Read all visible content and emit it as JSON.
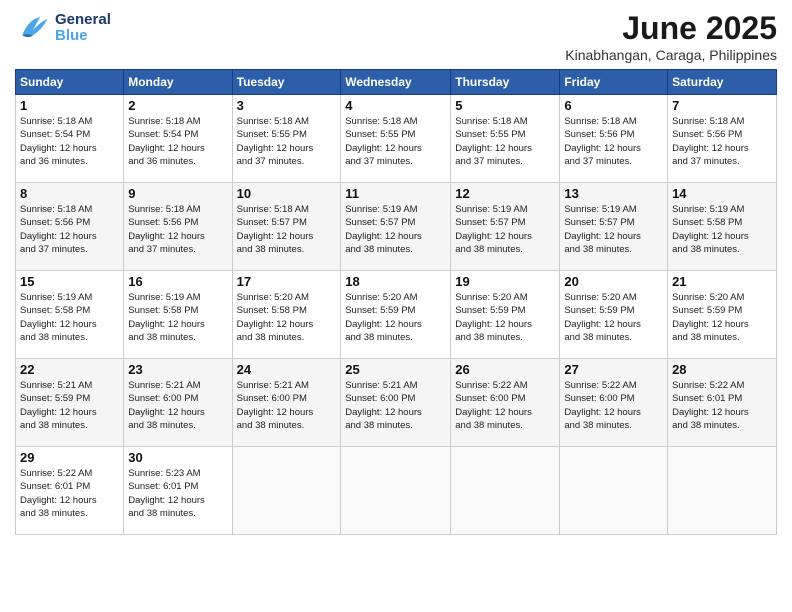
{
  "header": {
    "logo_general": "General",
    "logo_blue": "Blue",
    "title": "June 2025",
    "subtitle": "Kinabhangan, Caraga, Philippines"
  },
  "days_of_week": [
    "Sunday",
    "Monday",
    "Tuesday",
    "Wednesday",
    "Thursday",
    "Friday",
    "Saturday"
  ],
  "weeks": [
    [
      {
        "day": "1",
        "info": "Sunrise: 5:18 AM\nSunset: 5:54 PM\nDaylight: 12 hours\nand 36 minutes."
      },
      {
        "day": "2",
        "info": "Sunrise: 5:18 AM\nSunset: 5:54 PM\nDaylight: 12 hours\nand 36 minutes."
      },
      {
        "day": "3",
        "info": "Sunrise: 5:18 AM\nSunset: 5:55 PM\nDaylight: 12 hours\nand 37 minutes."
      },
      {
        "day": "4",
        "info": "Sunrise: 5:18 AM\nSunset: 5:55 PM\nDaylight: 12 hours\nand 37 minutes."
      },
      {
        "day": "5",
        "info": "Sunrise: 5:18 AM\nSunset: 5:55 PM\nDaylight: 12 hours\nand 37 minutes."
      },
      {
        "day": "6",
        "info": "Sunrise: 5:18 AM\nSunset: 5:56 PM\nDaylight: 12 hours\nand 37 minutes."
      },
      {
        "day": "7",
        "info": "Sunrise: 5:18 AM\nSunset: 5:56 PM\nDaylight: 12 hours\nand 37 minutes."
      }
    ],
    [
      {
        "day": "8",
        "info": "Sunrise: 5:18 AM\nSunset: 5:56 PM\nDaylight: 12 hours\nand 37 minutes."
      },
      {
        "day": "9",
        "info": "Sunrise: 5:18 AM\nSunset: 5:56 PM\nDaylight: 12 hours\nand 37 minutes."
      },
      {
        "day": "10",
        "info": "Sunrise: 5:18 AM\nSunset: 5:57 PM\nDaylight: 12 hours\nand 38 minutes."
      },
      {
        "day": "11",
        "info": "Sunrise: 5:19 AM\nSunset: 5:57 PM\nDaylight: 12 hours\nand 38 minutes."
      },
      {
        "day": "12",
        "info": "Sunrise: 5:19 AM\nSunset: 5:57 PM\nDaylight: 12 hours\nand 38 minutes."
      },
      {
        "day": "13",
        "info": "Sunrise: 5:19 AM\nSunset: 5:57 PM\nDaylight: 12 hours\nand 38 minutes."
      },
      {
        "day": "14",
        "info": "Sunrise: 5:19 AM\nSunset: 5:58 PM\nDaylight: 12 hours\nand 38 minutes."
      }
    ],
    [
      {
        "day": "15",
        "info": "Sunrise: 5:19 AM\nSunset: 5:58 PM\nDaylight: 12 hours\nand 38 minutes."
      },
      {
        "day": "16",
        "info": "Sunrise: 5:19 AM\nSunset: 5:58 PM\nDaylight: 12 hours\nand 38 minutes."
      },
      {
        "day": "17",
        "info": "Sunrise: 5:20 AM\nSunset: 5:58 PM\nDaylight: 12 hours\nand 38 minutes."
      },
      {
        "day": "18",
        "info": "Sunrise: 5:20 AM\nSunset: 5:59 PM\nDaylight: 12 hours\nand 38 minutes."
      },
      {
        "day": "19",
        "info": "Sunrise: 5:20 AM\nSunset: 5:59 PM\nDaylight: 12 hours\nand 38 minutes."
      },
      {
        "day": "20",
        "info": "Sunrise: 5:20 AM\nSunset: 5:59 PM\nDaylight: 12 hours\nand 38 minutes."
      },
      {
        "day": "21",
        "info": "Sunrise: 5:20 AM\nSunset: 5:59 PM\nDaylight: 12 hours\nand 38 minutes."
      }
    ],
    [
      {
        "day": "22",
        "info": "Sunrise: 5:21 AM\nSunset: 5:59 PM\nDaylight: 12 hours\nand 38 minutes."
      },
      {
        "day": "23",
        "info": "Sunrise: 5:21 AM\nSunset: 6:00 PM\nDaylight: 12 hours\nand 38 minutes."
      },
      {
        "day": "24",
        "info": "Sunrise: 5:21 AM\nSunset: 6:00 PM\nDaylight: 12 hours\nand 38 minutes."
      },
      {
        "day": "25",
        "info": "Sunrise: 5:21 AM\nSunset: 6:00 PM\nDaylight: 12 hours\nand 38 minutes."
      },
      {
        "day": "26",
        "info": "Sunrise: 5:22 AM\nSunset: 6:00 PM\nDaylight: 12 hours\nand 38 minutes."
      },
      {
        "day": "27",
        "info": "Sunrise: 5:22 AM\nSunset: 6:00 PM\nDaylight: 12 hours\nand 38 minutes."
      },
      {
        "day": "28",
        "info": "Sunrise: 5:22 AM\nSunset: 6:01 PM\nDaylight: 12 hours\nand 38 minutes."
      }
    ],
    [
      {
        "day": "29",
        "info": "Sunrise: 5:22 AM\nSunset: 6:01 PM\nDaylight: 12 hours\nand 38 minutes."
      },
      {
        "day": "30",
        "info": "Sunrise: 5:23 AM\nSunset: 6:01 PM\nDaylight: 12 hours\nand 38 minutes."
      },
      {
        "day": "",
        "info": ""
      },
      {
        "day": "",
        "info": ""
      },
      {
        "day": "",
        "info": ""
      },
      {
        "day": "",
        "info": ""
      },
      {
        "day": "",
        "info": ""
      }
    ]
  ]
}
